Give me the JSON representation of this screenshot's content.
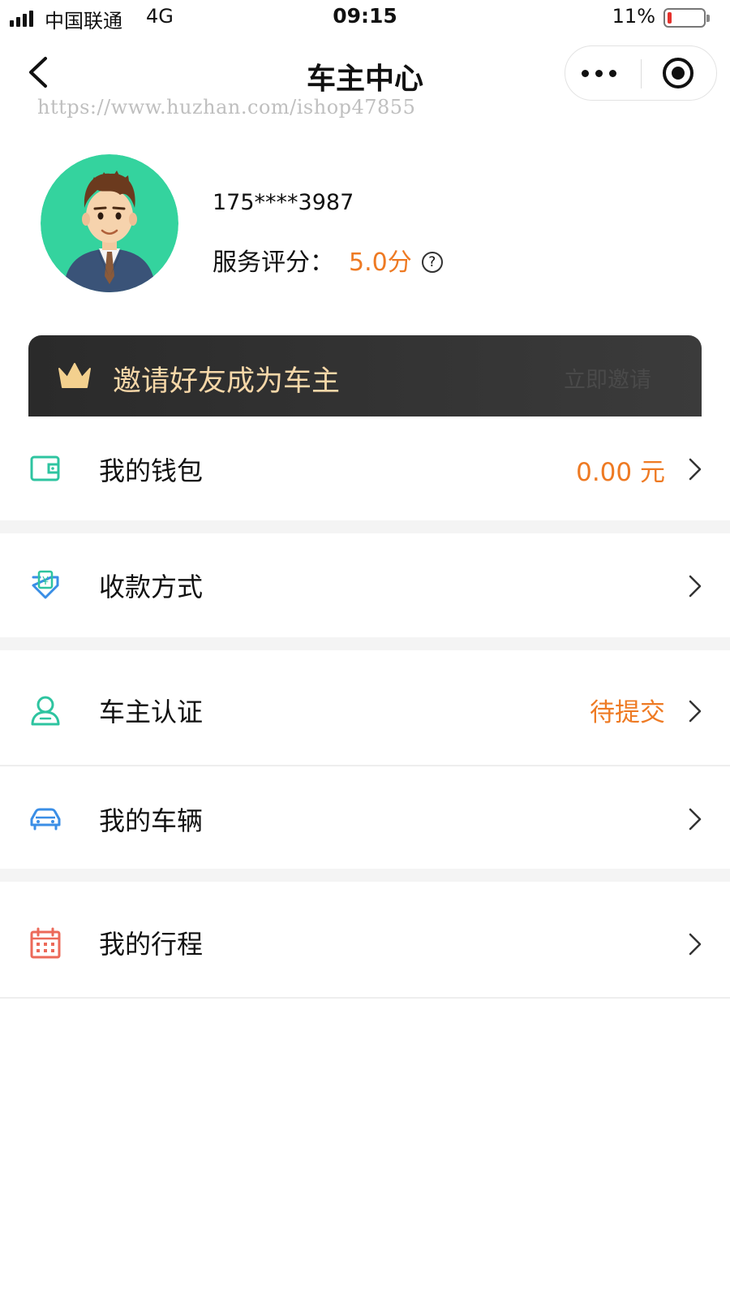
{
  "status_bar": {
    "carrier": "中国联通",
    "network": "4G",
    "time": "09:15",
    "battery_percent": "11%",
    "battery_level": 0.11
  },
  "nav": {
    "title": "车主中心"
  },
  "watermark": "https://www.huzhan.com/ishop47855",
  "profile": {
    "phone": "175****3987",
    "rating_label": "服务评分：",
    "rating_value": "5.0分",
    "help_icon": "?"
  },
  "invite_banner": {
    "text": "邀请好友成为车主",
    "action": "立即邀请"
  },
  "menu": {
    "wallet": {
      "label": "我的钱包",
      "value": "0.00 元",
      "icon": "wallet-icon"
    },
    "payment": {
      "label": "收款方式",
      "icon": "yuan-receive-icon"
    },
    "certification": {
      "label": "车主认证",
      "value": "待提交",
      "icon": "user-icon"
    },
    "vehicle": {
      "label": "我的车辆",
      "icon": "car-icon"
    },
    "trips": {
      "label": "我的行程",
      "icon": "calendar-icon"
    }
  },
  "colors": {
    "accent": "#ee7a23",
    "teal": "#2ec4a0",
    "blue": "#3a8ee6",
    "banner_bg": "#2e2e2e",
    "banner_text": "#f6d7a8"
  }
}
